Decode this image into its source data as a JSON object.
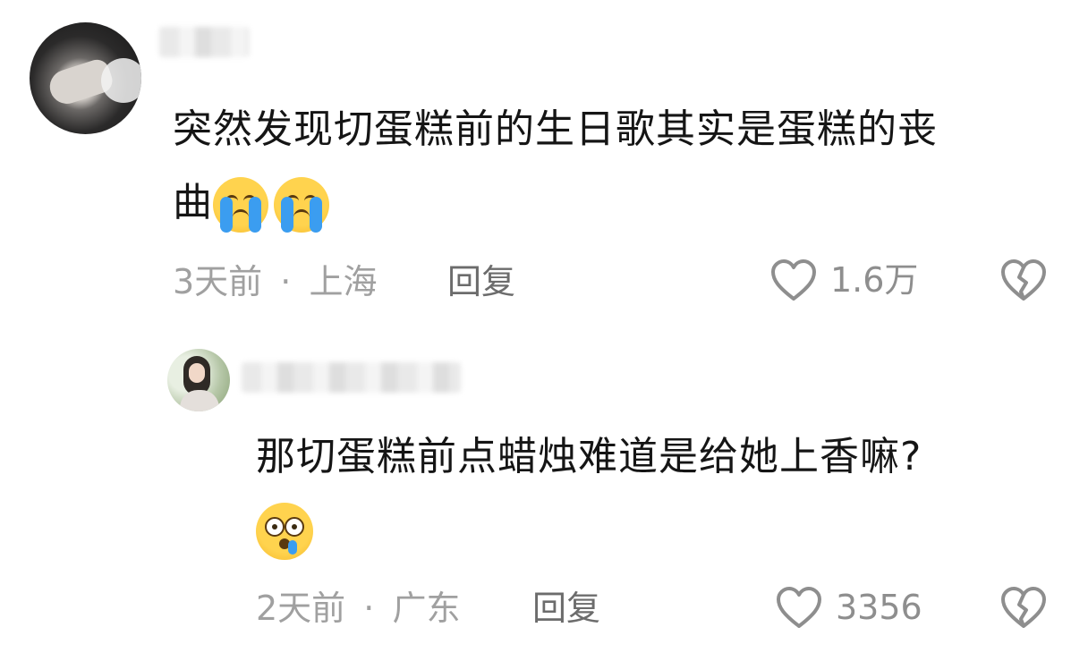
{
  "comments": [
    {
      "text_line1": "突然发现切蛋糕前的生日歌其实是蛋糕的丧",
      "text_line2": "曲",
      "emojis": [
        "loudly-crying-face",
        "loudly-crying-face"
      ],
      "time": "3天前",
      "separator": "·",
      "location": "上海",
      "reply_label": "回复",
      "like_count": "1.6万"
    },
    {
      "text_line1": "那切蛋糕前点蜡烛难道是给她上香嘛?",
      "emojis": [
        "astonished-face-with-tear"
      ],
      "time": "2天前",
      "separator": "·",
      "location": "广东",
      "reply_label": "回复",
      "like_count": "3356"
    }
  ],
  "colors": {
    "text": "#151515",
    "meta": "#a0a0a0",
    "reply": "#6c6c6c",
    "icon": "#8e8e8e"
  }
}
